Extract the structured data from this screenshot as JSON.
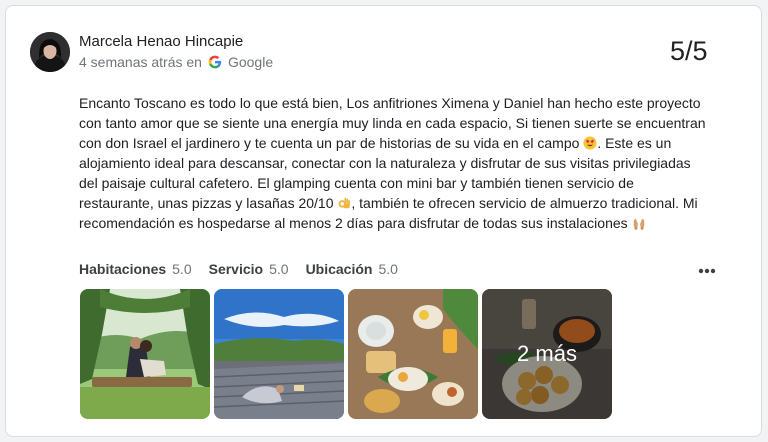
{
  "review": {
    "author": "Marcela Henao Hincapie",
    "time": "4 semanas atrás en",
    "source": "Google",
    "score": "5/5",
    "text_segments": [
      "Encanto Toscano es todo lo que está bien, Los anfitriones Ximena y Daniel han hecho este proyecto con tanto amor que se siente una energía muy linda en cada espacio, Si tienen suerte se encuentran con don Israel el jardinero y te cuenta un par de historias de su vida en el campo ",
      ". Este es un alojamiento ideal para descansar, conectar con la naturaleza y disfrutar de sus visitas privilegiadas del paisaje cultural cafetero. El glamping cuenta con mini bar y también tienen servicio de restaurante, unas pizzas y lasañas 20/10 ",
      ", también te ofrecen servicio de almuerzo tradicional. Mi recomendación es hospedarse al menos 2 días para disfrutar de todas sus instalaciones "
    ],
    "emojis": [
      "smiling-face-with-heart-eyes",
      "ok-hand",
      "raising-hands"
    ]
  },
  "ratings": [
    {
      "label": "Habitaciones",
      "value": "5.0"
    },
    {
      "label": "Servicio",
      "value": "5.0"
    },
    {
      "label": "Ubicación",
      "value": "5.0"
    }
  ],
  "photos": {
    "more_label": "2 más"
  },
  "icons": {
    "source_logo": "google-g-icon",
    "more": "more-horizontal-icon"
  },
  "colors": {
    "text": "#202124",
    "secondary": "#70757a",
    "border": "#dadce0"
  }
}
